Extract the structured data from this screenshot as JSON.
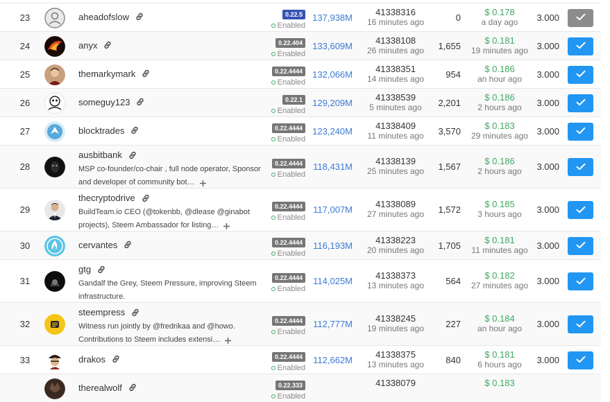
{
  "enabled_label": "Enabled",
  "colors": {
    "accent": "#2196f3",
    "votes": "#3a7bd5",
    "price": "#3ea861",
    "badge": "#767676",
    "badge_latest": "#3852b5"
  },
  "witnesses": [
    {
      "rank": "23",
      "name": "aheadofslow",
      "desc": "",
      "version": "0.22.5",
      "latest": true,
      "votes": "137,938M",
      "block": "41338316",
      "block_time": "16 minutes ago",
      "missed": "0",
      "price": "$ 0.178",
      "price_time": "a day ago",
      "ratio": "3.000",
      "voted": true,
      "avatar": "default-user-icon"
    },
    {
      "rank": "24",
      "name": "anyx",
      "desc": "",
      "version": "0.22.404",
      "latest": false,
      "votes": "133,609M",
      "block": "41338108",
      "block_time": "26 minutes ago",
      "missed": "1,655",
      "price": "$ 0.181",
      "price_time": "19 minutes ago",
      "ratio": "3.000",
      "voted": false,
      "avatar": "flame-avatar"
    },
    {
      "rank": "25",
      "name": "themarkymark",
      "desc": "",
      "version": "0.22.4444",
      "latest": false,
      "votes": "132,066M",
      "block": "41338351",
      "block_time": "14 minutes ago",
      "missed": "954",
      "price": "$ 0.186",
      "price_time": "an hour ago",
      "ratio": "3.000",
      "voted": false,
      "avatar": "person-avatar"
    },
    {
      "rank": "26",
      "name": "someguy123",
      "desc": "",
      "version": "0.22.1",
      "latest": false,
      "votes": "129,209M",
      "block": "41338539",
      "block_time": "5 minutes ago",
      "missed": "2,201",
      "price": "$ 0.186",
      "price_time": "2 hours ago",
      "ratio": "3.000",
      "voted": false,
      "avatar": "cartoon-avatar"
    },
    {
      "rank": "27",
      "name": "blocktrades",
      "desc": "",
      "version": "0.22.4444",
      "latest": false,
      "votes": "123,240M",
      "block": "41338409",
      "block_time": "11 minutes ago",
      "missed": "3,570",
      "price": "$ 0.183",
      "price_time": "29 minutes ago",
      "ratio": "3.000",
      "voted": false,
      "avatar": "bird-logo-avatar"
    },
    {
      "rank": "28",
      "name": "ausbitbank",
      "desc": "MSP co-founder/co-chair , full node operator, Sponsor and developer of community bot…",
      "version": "0.22.4444",
      "latest": false,
      "votes": "118,431M",
      "block": "41338139",
      "block_time": "25 minutes ago",
      "missed": "1,567",
      "price": "$ 0.186",
      "price_time": "2 hours ago",
      "ratio": "3.000",
      "voted": false,
      "avatar": "dark-face-avatar"
    },
    {
      "rank": "29",
      "name": "thecryptodrive",
      "desc": "BuildTeam.io CEO (@tokenbb, @dlease @ginabot projects), Steem Ambassador for listing…",
      "version": "0.22.4444",
      "latest": false,
      "votes": "117,007M",
      "block": "41338089",
      "block_time": "27 minutes ago",
      "missed": "1,572",
      "price": "$ 0.185",
      "price_time": "3 hours ago",
      "ratio": "3.000",
      "voted": false,
      "avatar": "man-suit-avatar"
    },
    {
      "rank": "30",
      "name": "cervantes",
      "desc": "",
      "version": "0.22.4444",
      "latest": false,
      "votes": "116,193M",
      "block": "41338223",
      "block_time": "20 minutes ago",
      "missed": "1,705",
      "price": "$ 0.181",
      "price_time": "11 minutes ago",
      "ratio": "3.000",
      "voted": false,
      "avatar": "flame-logo-avatar"
    },
    {
      "rank": "31",
      "name": "gtg",
      "desc": "Gandalf the Grey, Steem Pressure, improving Steem infrastructure.",
      "version": "0.22.4444",
      "latest": false,
      "votes": "114,025M",
      "block": "41338373",
      "block_time": "13 minutes ago",
      "missed": "564",
      "price": "$ 0.182",
      "price_time": "27 minutes ago",
      "ratio": "3.000",
      "voted": false,
      "avatar": "wizard-avatar"
    },
    {
      "rank": "32",
      "name": "steempress",
      "desc": "Witness run jointly by @fredrikaa and @howo. Contributions to Steem includes extensi…",
      "version": "0.22.4444",
      "latest": false,
      "votes": "112,777M",
      "block": "41338245",
      "block_time": "19 minutes ago",
      "missed": "227",
      "price": "$ 0.184",
      "price_time": "an hour ago",
      "ratio": "3.000",
      "voted": false,
      "avatar": "yellow-logo-avatar"
    },
    {
      "rank": "33",
      "name": "drakos",
      "desc": "",
      "version": "0.22.4444",
      "latest": false,
      "votes": "112,662M",
      "block": "41338375",
      "block_time": "13 minutes ago",
      "missed": "840",
      "price": "$ 0.181",
      "price_time": "6 hours ago",
      "ratio": "3.000",
      "voted": false,
      "avatar": "pirate-avatar"
    },
    {
      "rank": "",
      "name": "therealwolf",
      "desc": "",
      "version": "0.22.333",
      "latest": false,
      "votes": "",
      "block": "41338079",
      "block_time": "",
      "missed": "",
      "price": "$ 0.183",
      "price_time": "",
      "ratio": "",
      "voted": false,
      "avatar": "wolf-avatar"
    }
  ]
}
